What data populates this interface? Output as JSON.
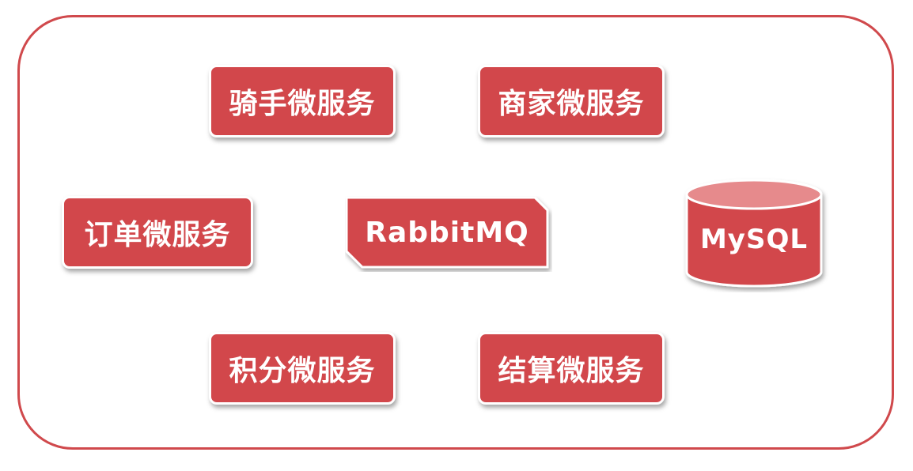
{
  "diagram": {
    "nodes": {
      "rider_service": "骑手微服务",
      "merchant_service": "商家微服务",
      "order_service": "订单微服务",
      "message_queue": "RabbitMQ",
      "database": "MySQL",
      "points_service": "积分微服务",
      "settlement_service": "结算微服务"
    }
  },
  "colors": {
    "node_fill": "#d2474b",
    "frame_border": "#d0494c",
    "db_top": "#e68a8c",
    "text": "#ffffff"
  }
}
